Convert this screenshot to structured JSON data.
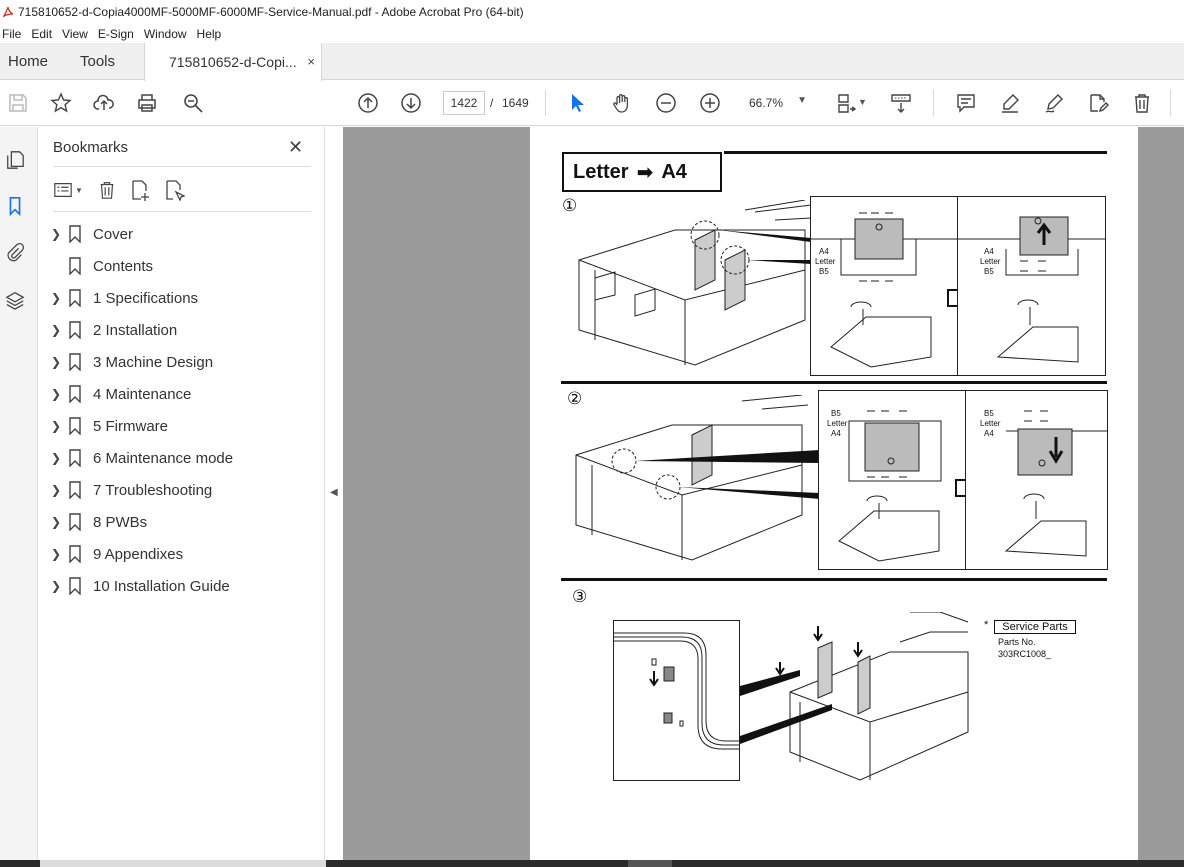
{
  "window": {
    "title": "715810652-d-Copia4000MF-5000MF-6000MF-Service-Manual.pdf - Adobe Acrobat Pro (64-bit)"
  },
  "menu": {
    "items": [
      "File",
      "Edit",
      "View",
      "E-Sign",
      "Window",
      "Help"
    ]
  },
  "tabs": {
    "home": "Home",
    "tools": "Tools",
    "document": "715810652-d-Copi...",
    "close_glyph": "×"
  },
  "toolbar": {
    "current_page": "1422",
    "page_separator": "/",
    "total_pages": "1649",
    "zoom": "66.7%"
  },
  "bookmarks": {
    "header": "Bookmarks",
    "close_glyph": "✕",
    "items": [
      {
        "label": "Cover",
        "expandable": true
      },
      {
        "label": "Contents",
        "expandable": false
      },
      {
        "label": "1 Specifications",
        "expandable": true
      },
      {
        "label": "2 Installation",
        "expandable": true
      },
      {
        "label": "3 Machine Design",
        "expandable": true
      },
      {
        "label": "4 Maintenance",
        "expandable": true
      },
      {
        "label": "5 Firmware",
        "expandable": true
      },
      {
        "label": "6 Maintenance mode",
        "expandable": true
      },
      {
        "label": "7 Troubleshooting",
        "expandable": true
      },
      {
        "label": "8 PWBs",
        "expandable": true
      },
      {
        "label": "9 Appendixes",
        "expandable": true
      },
      {
        "label": "10 Installation Guide",
        "expandable": true
      }
    ]
  },
  "document": {
    "heading_from": "Letter",
    "heading_arrow": "➡",
    "heading_to": "A4",
    "steps": [
      "①",
      "②",
      "③"
    ],
    "labels_step1_left": [
      "A4",
      "Letter",
      "B5"
    ],
    "labels_step1_right": [
      "A4",
      "Letter",
      "B5"
    ],
    "labels_step2_left": [
      "B5",
      "Letter",
      "A4"
    ],
    "labels_step2_right": [
      "B5",
      "Letter",
      "A4"
    ],
    "service_parts_star": "*",
    "service_parts_label": "Service Parts",
    "parts_no_label": "Parts No.",
    "parts_no_value": "303RC1008_"
  },
  "colors": {
    "viewport_bg": "#9a9a9a",
    "accent_blue": "#1473e6",
    "pdf_red": "#d62b1f"
  }
}
